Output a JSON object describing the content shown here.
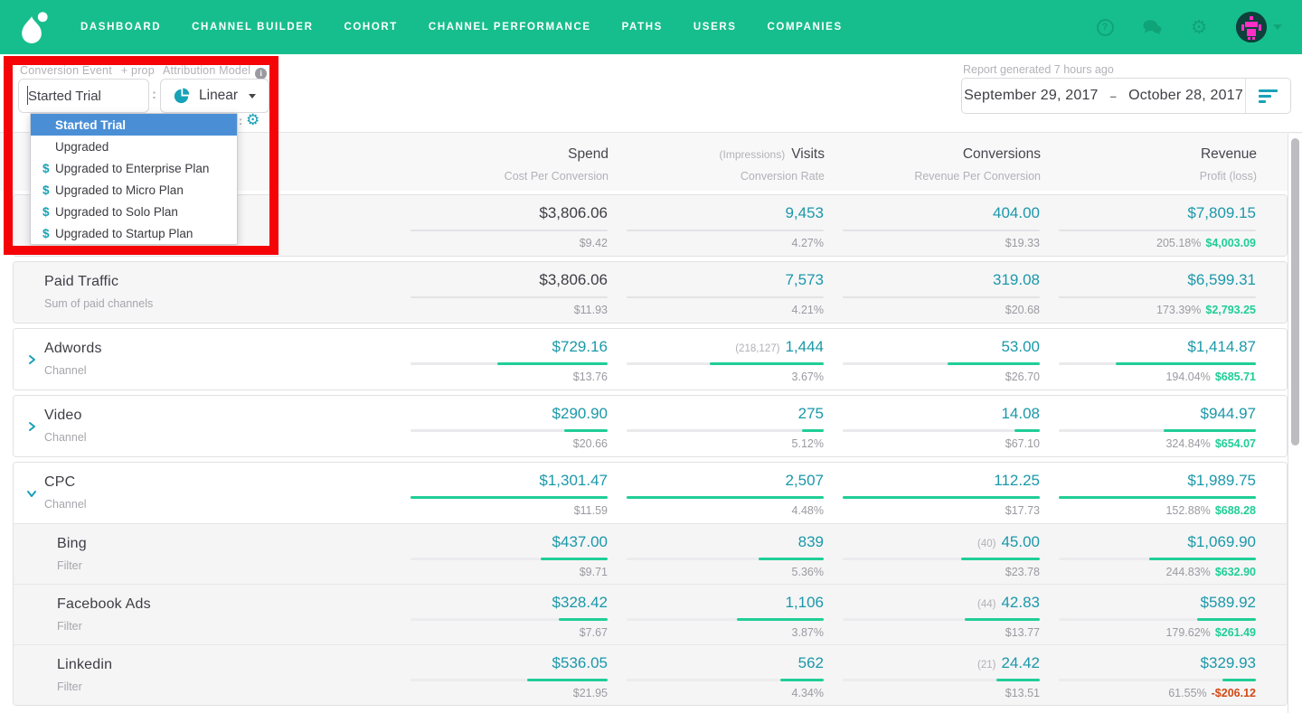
{
  "colors": {
    "nav_green": "#17be8d",
    "nav_icon_green": "#0fa478",
    "teal_value": "#1b98a9",
    "teal_icon": "#18a2b8",
    "bar_green": "#1fce96",
    "profit_green": "#1fce96",
    "negative_red": "#d14a16",
    "highlight_blue": "#4a8fd6",
    "frame_red": "#f50307"
  },
  "nav": {
    "items": [
      "DASHBOARD",
      "CHANNEL BUILDER",
      "COHORT",
      "CHANNEL PERFORMANCE",
      "PATHS",
      "USERS",
      "COMPANIES"
    ]
  },
  "filters": {
    "conversion_event_label": "Conversion Event",
    "prop_label": "+ prop",
    "conversion_event_value": "Started Trial",
    "separator": ":",
    "attribution_model_label": "Attribution Model",
    "attribution_model_value": "Linear",
    "dropdown_options": [
      {
        "label": "Started Trial",
        "monetary": false,
        "selected": true
      },
      {
        "label": "Upgraded",
        "monetary": false,
        "selected": false
      },
      {
        "label": "Upgraded to Enterprise Plan",
        "monetary": true,
        "selected": false
      },
      {
        "label": "Upgraded to Micro Plan",
        "monetary": true,
        "selected": false
      },
      {
        "label": "Upgraded to Solo Plan",
        "monetary": true,
        "selected": false
      },
      {
        "label": "Upgraded to Startup Plan",
        "monetary": true,
        "selected": false
      }
    ]
  },
  "report": {
    "generated_label": "Report generated 7 hours ago",
    "date_start": "September 29, 2017",
    "date_separator": "–",
    "date_end": "October 28, 2017"
  },
  "table": {
    "columns": [
      {
        "title": "Spend",
        "prefix": "",
        "subtitle": "Cost Per Conversion"
      },
      {
        "title": "Visits",
        "prefix": "(Impressions)",
        "subtitle": "Conversion Rate"
      },
      {
        "title": "Conversions",
        "prefix": "",
        "subtitle": "Revenue Per Conversion"
      },
      {
        "title": "Revenue",
        "prefix": "",
        "subtitle": "Profit (loss)"
      }
    ],
    "cards": [
      {
        "rows": [
          {
            "name": "",
            "subtitle": "",
            "chevron": null,
            "sub": false,
            "gray": true,
            "cells": [
              {
                "value": "$3,806.06",
                "sub": "$9.42",
                "dark": true,
                "bar": null
              },
              {
                "value": "9,453",
                "sub": "4.27%",
                "bar": null
              },
              {
                "value": "404.00",
                "sub": "$19.33",
                "bar": null
              },
              {
                "value": "$7,809.15",
                "sub": "205.18%",
                "profit": "$4,003.09",
                "negative": false,
                "bar": null
              }
            ]
          }
        ]
      },
      {
        "rows": [
          {
            "name": "Paid Traffic",
            "subtitle": "Sum of paid channels",
            "chevron": null,
            "sub": false,
            "gray": true,
            "cells": [
              {
                "value": "$3,806.06",
                "sub": "$11.93",
                "dark": true,
                "bar": null
              },
              {
                "value": "7,573",
                "sub": "4.21%",
                "bar": null
              },
              {
                "value": "319.08",
                "sub": "$20.68",
                "bar": null
              },
              {
                "value": "$6,599.31",
                "sub": "173.39%",
                "profit": "$2,793.25",
                "negative": false,
                "bar": null
              }
            ]
          }
        ]
      },
      {
        "rows": [
          {
            "name": "Adwords",
            "subtitle": "Channel",
            "chevron": "right",
            "sub": false,
            "gray": false,
            "cells": [
              {
                "value": "$729.16",
                "sub": "$13.76",
                "bar": 0.56
              },
              {
                "prefix": "(218,127)",
                "value": "1,444",
                "sub": "3.67%",
                "bar": 0.58
              },
              {
                "value": "53.00",
                "sub": "$26.70",
                "bar": 0.47
              },
              {
                "value": "$1,414.87",
                "sub": "194.04%",
                "profit": "$685.71",
                "negative": false,
                "bar": 0.71
              }
            ]
          }
        ]
      },
      {
        "rows": [
          {
            "name": "Video",
            "subtitle": "Channel",
            "chevron": "right",
            "sub": false,
            "gray": false,
            "cells": [
              {
                "value": "$290.90",
                "sub": "$20.66",
                "bar": 0.22
              },
              {
                "value": "275",
                "sub": "5.12%",
                "bar": 0.11
              },
              {
                "value": "14.08",
                "sub": "$67.10",
                "bar": 0.13
              },
              {
                "value": "$944.97",
                "sub": "324.84%",
                "profit": "$654.07",
                "negative": false,
                "bar": 0.47
              }
            ]
          }
        ]
      },
      {
        "rows": [
          {
            "name": "CPC",
            "subtitle": "Channel",
            "chevron": "down",
            "sub": false,
            "gray": false,
            "cells": [
              {
                "value": "$1,301.47",
                "sub": "$11.59",
                "bar": 1
              },
              {
                "value": "2,507",
                "sub": "4.48%",
                "bar": 1
              },
              {
                "value": "112.25",
                "sub": "$17.73",
                "bar": 1
              },
              {
                "value": "$1,989.75",
                "sub": "152.88%",
                "profit": "$688.28",
                "negative": false,
                "bar": 1
              }
            ]
          },
          {
            "name": "Bing",
            "subtitle": "Filter",
            "chevron": null,
            "sub": true,
            "gray": true,
            "cells": [
              {
                "value": "$437.00",
                "sub": "$9.71",
                "bar": 0.34
              },
              {
                "value": "839",
                "sub": "5.36%",
                "bar": 0.33
              },
              {
                "prefix": "(40)",
                "value": "45.00",
                "sub": "$23.78",
                "bar": 0.4
              },
              {
                "value": "$1,069.90",
                "sub": "244.83%",
                "profit": "$632.90",
                "negative": false,
                "bar": 0.54
              }
            ]
          },
          {
            "name": "Facebook Ads",
            "subtitle": "Filter",
            "chevron": null,
            "sub": true,
            "gray": true,
            "cells": [
              {
                "value": "$328.42",
                "sub": "$7.67",
                "bar": 0.25
              },
              {
                "value": "1,106",
                "sub": "3.87%",
                "bar": 0.44
              },
              {
                "prefix": "(44)",
                "value": "42.83",
                "sub": "$13.77",
                "bar": 0.38
              },
              {
                "value": "$589.92",
                "sub": "179.62%",
                "profit": "$261.49",
                "negative": false,
                "bar": 0.3
              }
            ]
          },
          {
            "name": "Linkedin",
            "subtitle": "Filter",
            "chevron": null,
            "sub": true,
            "gray": true,
            "cells": [
              {
                "value": "$536.05",
                "sub": "$21.95",
                "bar": 0.41
              },
              {
                "value": "562",
                "sub": "4.34%",
                "bar": 0.22
              },
              {
                "prefix": "(21)",
                "value": "24.42",
                "sub": "$13.51",
                "bar": 0.22
              },
              {
                "value": "$329.93",
                "sub": "61.55%",
                "profit": "-$206.12",
                "negative": true,
                "bar": 0.17
              }
            ]
          }
        ]
      }
    ]
  }
}
